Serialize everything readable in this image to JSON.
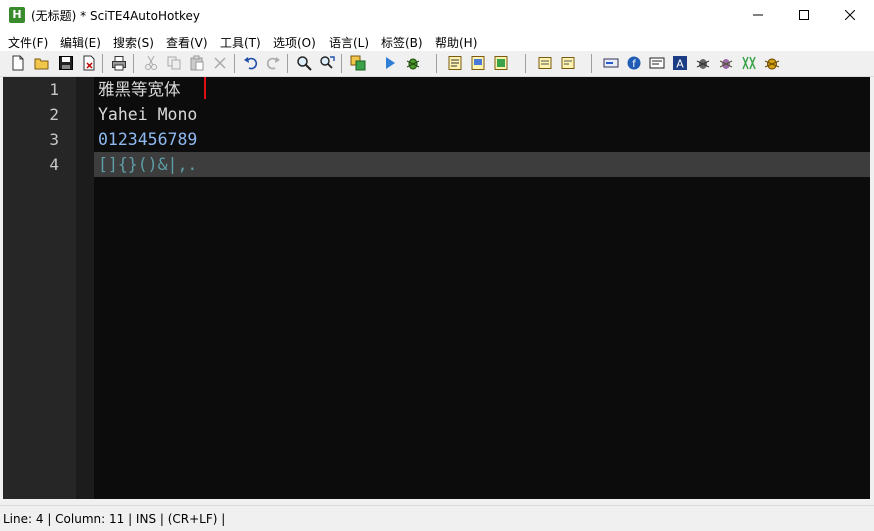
{
  "window": {
    "title": "(无标题) * SciTE4AutoHotkey",
    "icon": "scite-app-icon",
    "icon_glyph": "H"
  },
  "menu": [
    "文件(F)",
    "编辑(E)",
    "搜索(S)",
    "查看(V)",
    "工具(T)",
    "选项(O)",
    "语言(L)",
    "标签(B)",
    "帮助(H)"
  ],
  "toolbar": {
    "icons": [
      "new-file-icon",
      "open-folder-icon",
      "save-icon",
      "close-file-icon",
      "print-icon",
      "cut-icon",
      "copy-icon",
      "paste-icon",
      "delete-icon",
      "undo-icon",
      "redo-icon",
      "find-icon",
      "replace-icon",
      "compile-icon",
      "run-icon",
      "debug-icon",
      "script-icon",
      "window-spy-icon",
      "help-doc-icon",
      "bookmark-icon",
      "bookmark-next-icon",
      "label-icon",
      "function-icon",
      "gui-icon",
      "font-icon",
      "bug-icon",
      "bug-red-icon",
      "hex-icon",
      "beetle-icon"
    ]
  },
  "editor": {
    "line_numbers": [
      "1",
      "2",
      "3",
      "4"
    ],
    "lines": [
      "雅黑等宽体",
      "Yahei Mono",
      "0123456789",
      "[]{}()&|,."
    ],
    "colors": {
      "background": "#0c0c0c",
      "text": "#d8d8d8",
      "number": "#8fb8f0",
      "operator": "#5d9ea8",
      "caret": "#e01010",
      "caret_line": "#3d3d3d"
    }
  },
  "status": {
    "text": "Line: 4 | Column: 11 | INS | (CR+LF) |"
  }
}
